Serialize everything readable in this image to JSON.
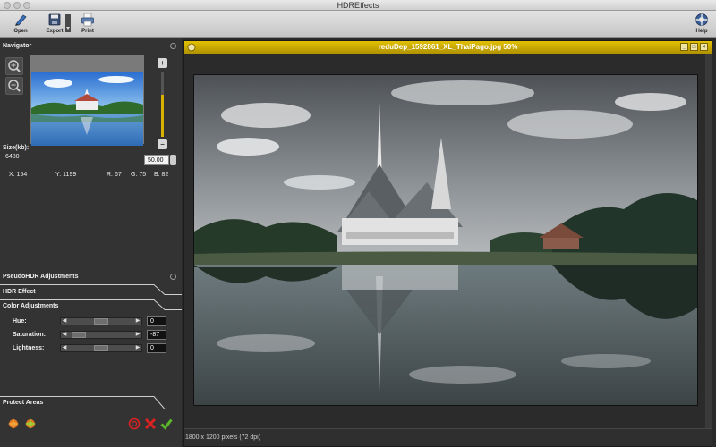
{
  "window": {
    "title": "HDREffects"
  },
  "toolbar": {
    "open": "Open",
    "export": "Export",
    "print": "Print",
    "help": "Help"
  },
  "navigator": {
    "title": "Navigator",
    "size_label": "Size(kb):",
    "size_value": "6480",
    "zoom_value": "50.00",
    "x": "X: 154",
    "y": "Y: 1199",
    "r": "R: 67",
    "g": "G: 75",
    "b": "B: 82"
  },
  "panels": {
    "pseudo": "PseudoHDR Adjustments",
    "hdr": "HDR Effect",
    "color": "Color Adjustments",
    "protect": "Protect Areas"
  },
  "adjustments": [
    {
      "label": "Hue:",
      "value": "0",
      "position": 0.5
    },
    {
      "label": "Saturation:",
      "value": "-87",
      "position": 0.1
    },
    {
      "label": "Lightness:",
      "value": "0",
      "position": 0.5
    }
  ],
  "image": {
    "title": "reduDep_1592861_XL_ThaiPago.jpg 50%",
    "status": "1800 x 1200 pixels (72 dpi)"
  },
  "colors": {
    "accent": "#d9b200",
    "panel": "#333333"
  }
}
